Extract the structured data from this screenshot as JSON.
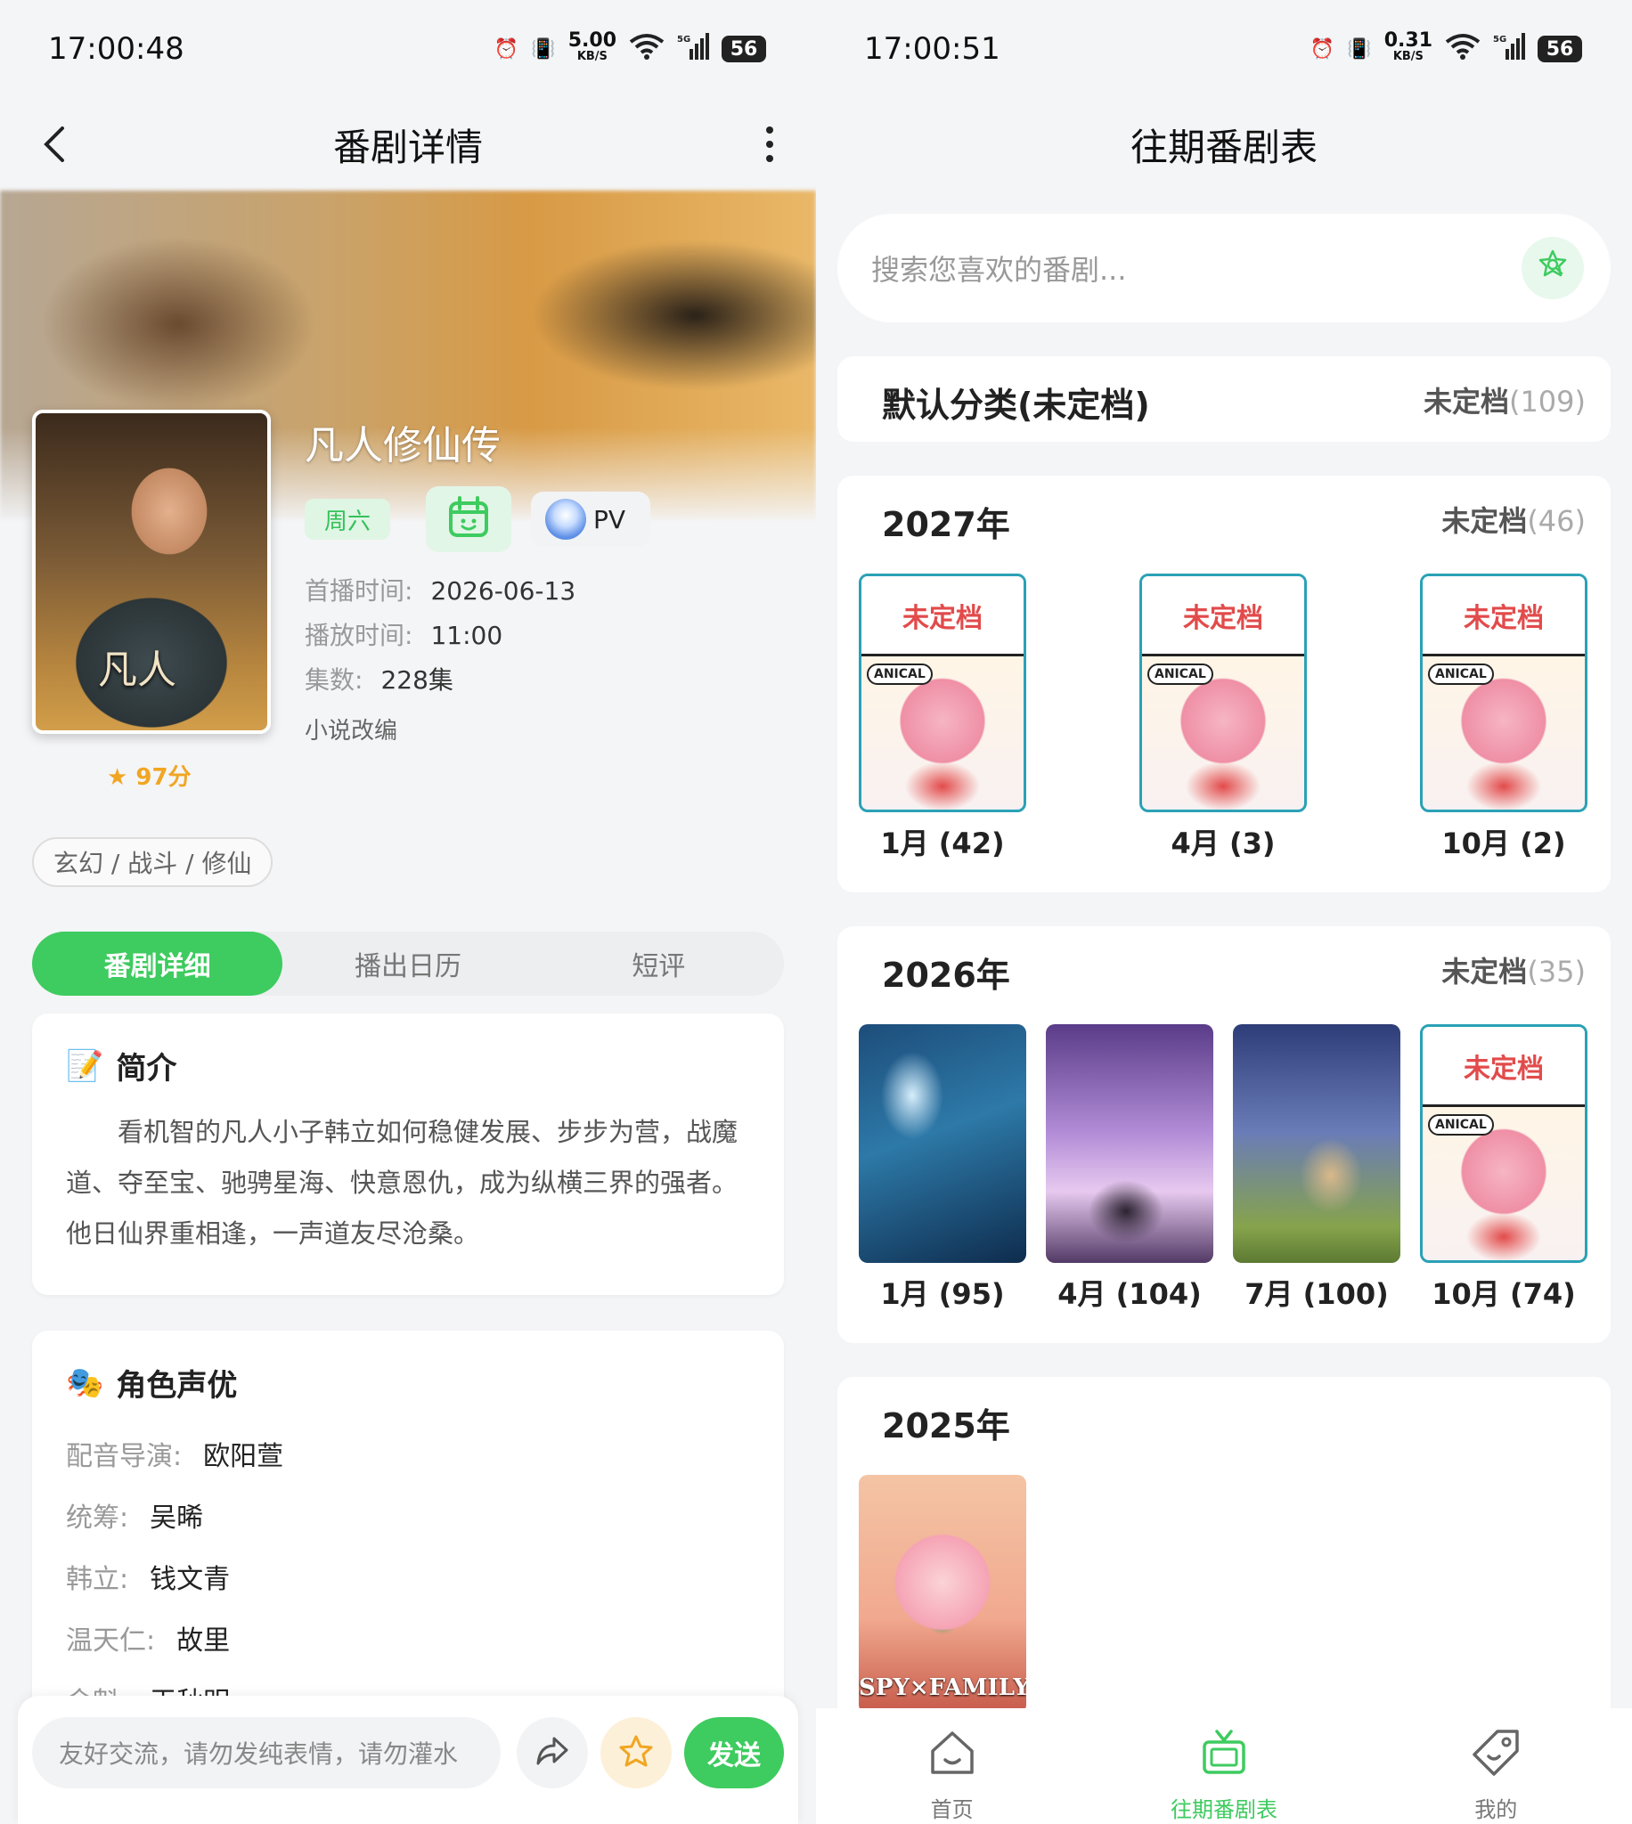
{
  "left": {
    "status": {
      "time": "17:00:48",
      "speed": "5.00",
      "speed_unit": "KB/S",
      "battery": "56",
      "net": "5G"
    },
    "nav": {
      "title": "番剧详情"
    },
    "show": {
      "title": "凡人修仙传",
      "poster_text": "凡人",
      "rating": "★ 97分",
      "day_badge": "周六",
      "pv_label": "PV",
      "premiere_label": "首播时间:",
      "premiere_value": "2026-06-13",
      "airtime_label": "播放时间:",
      "airtime_value": "11:00",
      "episodes_label": "集数:",
      "episodes_value": "228集",
      "source": "小说改编",
      "genres": "玄幻 / 战斗 / 修仙"
    },
    "tabs": [
      "番剧详细",
      "播出日历",
      "短评"
    ],
    "intro": {
      "title": "简介",
      "icon": "📝",
      "text": "看机智的凡人小子韩立如何稳健发展、步步为营，战魔道、夺至宝、驰骋星海、快意恩仇，成为纵横三界的强者。他日仙界重相逢，一声道友尽沧桑。"
    },
    "cast": {
      "title": "角色声优",
      "icon": "🎭",
      "rows": [
        {
          "role": "配音导演:",
          "name": "欧阳萱"
        },
        {
          "role": "统筹:",
          "name": "吴晞"
        },
        {
          "role": "韩立:",
          "name": "钱文青"
        },
        {
          "role": "温天仁:",
          "name": "故里"
        },
        {
          "role": "金魁:",
          "name": "王秋明"
        }
      ]
    },
    "comment": {
      "placeholder": "友好交流，请勿发纯表情，请勿灌水",
      "send": "发送"
    },
    "colors": {
      "accent": "#3ecb5f",
      "rating": "#f0a623"
    }
  },
  "right": {
    "status": {
      "time": "17:00:51",
      "speed": "0.31",
      "speed_unit": "KB/S",
      "battery": "56",
      "net": "5G"
    },
    "nav": {
      "title": "往期番剧表"
    },
    "search": {
      "placeholder": "搜索您喜欢的番剧..."
    },
    "default_category": {
      "title": "默认分类(未定档)",
      "count_label": "未定档",
      "count": "(109)"
    },
    "years": [
      {
        "year": "2027年",
        "count_label": "未定档",
        "count": "(46)",
        "seasons": [
          "1月 (42)",
          "4月 (3)",
          "10月 (2)"
        ]
      },
      {
        "year": "2026年",
        "count_label": "未定档",
        "count": "(35)",
        "seasons": [
          "1月 (95)",
          "4月 (104)",
          "7月 (100)",
          "10月 (74)"
        ]
      },
      {
        "year": "2025年",
        "poster_text": "SPY×FAMILY"
      }
    ],
    "placeholder_poster": {
      "headline": "未定档",
      "tag": "ANICAL"
    },
    "tabbar": [
      "首页",
      "往期番剧表",
      "我的"
    ]
  }
}
